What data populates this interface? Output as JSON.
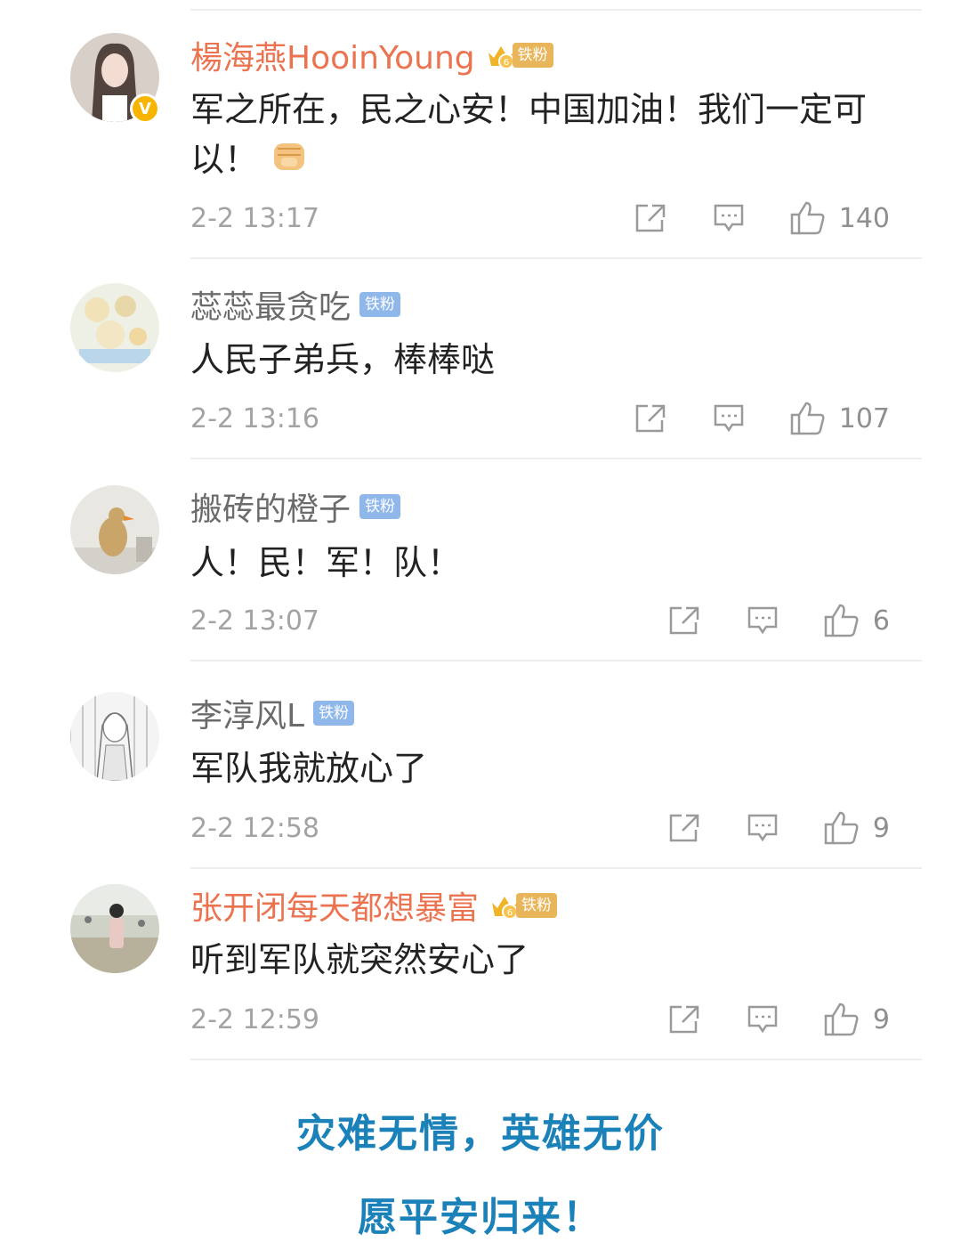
{
  "comments": [
    {
      "username": "楊海燕HooinYoung",
      "badge": "铁粉",
      "badge_level": "6",
      "verified": true,
      "text": "军之所在，民之心安！中国加油！我们一定可以！",
      "time": "2-2 13:17",
      "likes": "140"
    },
    {
      "username": "蕊蕊最贪吃",
      "badge": "铁粉",
      "text": "人民子弟兵，棒棒哒",
      "time": "2-2 13:16",
      "likes": "107"
    },
    {
      "username": "搬砖的橙子",
      "badge": "铁粉",
      "text": "人！民！军！队！",
      "time": "2-2 13:07",
      "likes": "6"
    },
    {
      "username": "李淳风L",
      "badge": "铁粉",
      "text": "军队我就放心了",
      "time": "2-2 12:58",
      "likes": "9"
    },
    {
      "username": "张开闭每天都想暴富",
      "badge": "铁粉",
      "badge_level": "6",
      "text": "听到军队就突然安心了",
      "time": "2-2 12:59",
      "likes": "9"
    }
  ],
  "caption": {
    "line1": "灾难无情，英雄无价",
    "line2": "愿平安归来！"
  },
  "colors": {
    "vip_name": "#eb7350",
    "name": "#6b6b6b",
    "caption": "#1b81b9",
    "fan_badge": "#8fb7ea"
  },
  "icons": [
    "share-icon",
    "comment-icon",
    "like-icon",
    "verified-icon",
    "crown-icon",
    "fist-emoji"
  ]
}
